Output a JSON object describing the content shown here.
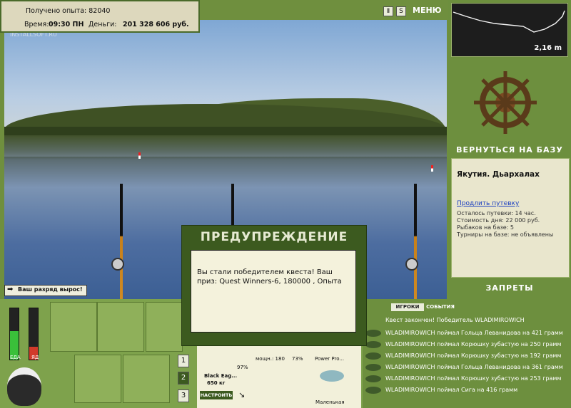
{
  "top": {
    "exp_label": "Получено опыта: 82040",
    "time_label": "Время:",
    "time_value": "09:30 ПН",
    "money_label": "Деньги:",
    "money_value": "201 328 606 руб.",
    "watermark": "INSTALLSOFT.RU",
    "menu_label": "МЕНЮ",
    "pause_icon": "pause-icon",
    "sound_icon": "sound-icon"
  },
  "depth": {
    "value": "2,16 m"
  },
  "right": {
    "back_to_base": "ВЕРНУТЬСЯ НА БАЗУ",
    "location": "Якутия. Дьархалах",
    "extend_link": "Продлить путевку",
    "lines": [
      "Осталось путевки: 14 час.",
      "Стоимость дня: 22 000 руб.",
      "Рыбаков на базе: 5",
      "Турниры на базе: не объявлены"
    ],
    "bans": "ЗАПРЕТЫ"
  },
  "scene": {
    "rank_up": "Ваш разряд вырос!"
  },
  "bottom": {
    "food_label": "ЕДА",
    "poison_label": "ЯД",
    "food_level": 0.55,
    "poison_level": 0.25,
    "pages": [
      "1",
      "2",
      "3"
    ],
    "rod_name": "Black Eag...",
    "rod_weight": "650 кг",
    "rod_percent": "97%",
    "reel_text": "мощн.: 180",
    "reel_percent": "73%",
    "lure_name": "Power Pro...",
    "bait_name": "Маленькая",
    "setup_button": "НАСТРОИТЬ"
  },
  "log": {
    "tabs": [
      "ИГРОКИ",
      "СОБЫТИЯ"
    ],
    "entries": [
      "Квест закончен! Победитель WLADIMIROWICH",
      "WLADIMIROWICH поймал Гольца Леванидова на 421 грамм",
      "WLADIMIROWICH поймал Корюшку зубастую на 250 грамм",
      "WLADIMIROWICH поймал Корюшку зубастую на 192 грамм",
      "WLADIMIROWICH поймал Гольца Леванидова на 361 грамм",
      "WLADIMIROWICH поймал Корюшку зубастую на 253 грамм",
      "WLADIMIROWICH поймал Сига на 416 грамм"
    ]
  },
  "dialog": {
    "title": "ПРЕДУПРЕЖДЕНИЕ",
    "text": "Вы стали победителем квеста! Ваш приз: Quest Winners-6, 180000 , Опыта"
  }
}
